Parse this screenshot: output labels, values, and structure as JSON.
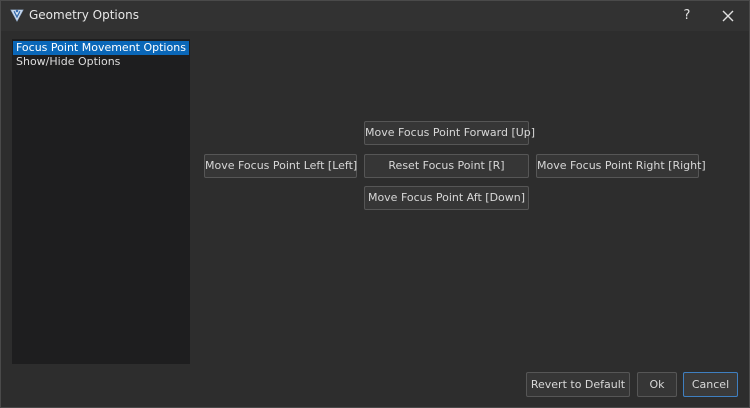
{
  "window": {
    "title": "Geometry Options",
    "help_label": "?",
    "icon": "app-logo-icon",
    "close_icon": "close-icon"
  },
  "sidebar": {
    "items": [
      {
        "label": "Focus Point Movement Options",
        "selected": true
      },
      {
        "label": "Show/Hide Options",
        "selected": false
      }
    ]
  },
  "controls": {
    "forward": "Move Focus Point Forward [Up]",
    "left": "Move Focus Point Left [Left]",
    "reset": "Reset Focus Point [R]",
    "right": "Move Focus Point Right [Right]",
    "aft": "Move Focus Point Aft [Down]"
  },
  "footer": {
    "revert": "Revert to Default",
    "ok": "Ok",
    "cancel": "Cancel"
  },
  "colors": {
    "selection": "#0a67b8",
    "default_button_border": "#3f7fc0"
  }
}
